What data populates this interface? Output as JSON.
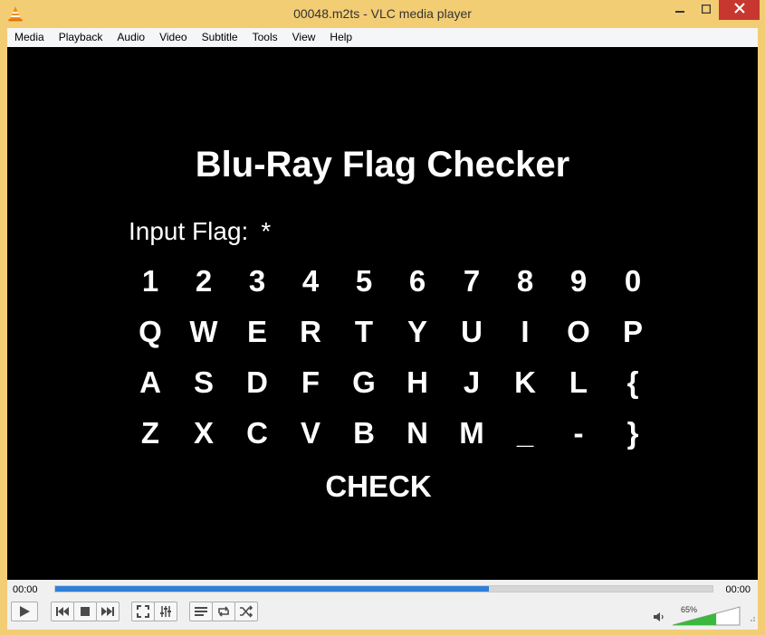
{
  "window": {
    "title": "00048.m2ts - VLC media player"
  },
  "menu": [
    "Media",
    "Playback",
    "Audio",
    "Video",
    "Subtitle",
    "Tools",
    "View",
    "Help"
  ],
  "video": {
    "heading": "Blu-Ray Flag Checker",
    "input_label": "Input Flag:",
    "input_value": "*",
    "keyboard": [
      [
        "1",
        "2",
        "3",
        "4",
        "5",
        "6",
        "7",
        "8",
        "9",
        "0"
      ],
      [
        "Q",
        "W",
        "E",
        "R",
        "T",
        "Y",
        "U",
        "I",
        "O",
        "P"
      ],
      [
        "A",
        "S",
        "D",
        "F",
        "G",
        "H",
        "J",
        "K",
        "L",
        "{"
      ],
      [
        "Z",
        "X",
        "C",
        "V",
        "B",
        "N",
        "M",
        "_",
        "-",
        "}"
      ]
    ],
    "check_label": "CHECK"
  },
  "player": {
    "time_elapsed": "00:00",
    "time_total": "00:00",
    "seek_fraction": 0.66,
    "volume_label": "65%",
    "volume_fraction": 0.65,
    "accent_color": "#2f7fd6",
    "volume_color": "#3cb83c"
  }
}
